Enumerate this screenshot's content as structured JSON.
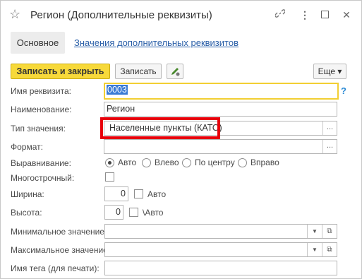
{
  "window": {
    "title": "Регион (Дополнительные реквизиты)",
    "star_icon": "☆",
    "link_icon": "🔗",
    "menu_icon": "⋮",
    "maximize_icon": "☐",
    "close_icon": "✕"
  },
  "tabs": {
    "main": "Основное",
    "values_link": "Значения дополнительных реквизитов"
  },
  "toolbar": {
    "save_close": "Записать и закрыть",
    "save": "Записать",
    "more": "Еще ▾"
  },
  "form": {
    "prop_name_label": "Имя реквизита:",
    "prop_name_value": "0003",
    "help": "?",
    "name_label": "Наименование:",
    "name_value": "Регион",
    "value_type_label": "Тип значения:",
    "value_type_value": "Населенные пункты (КАТО)",
    "format_label": "Формат:",
    "format_value": "",
    "select_btn": "...",
    "align_label": "Выравнивание:",
    "align_options": [
      "Авто",
      "Влево",
      "По центру",
      "Вправо"
    ],
    "align_selected": "Авто",
    "multiline_label": "Многострочный:",
    "width_label": "Ширина:",
    "width_value": "0",
    "width_auto": "Авто",
    "height_label": "Высота:",
    "height_value": "0",
    "height_auto": "\\Авто",
    "min_label": "Минимальное значение:",
    "max_label": "Максимальное значение:",
    "tag_label": "Имя тега (для печати):",
    "tag_value": "",
    "dropdown_icon": "▼",
    "open_icon": "⧉"
  }
}
